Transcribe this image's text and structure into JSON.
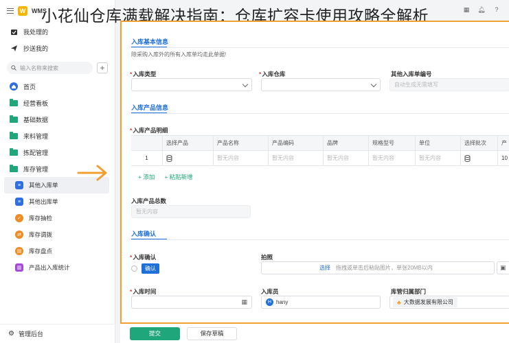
{
  "overlay_title": "小花仙仓库满载解决指南：仓库扩容卡使用攻略全解析",
  "app": {
    "name": "WMS",
    "logo_letter": "W"
  },
  "sidebar": {
    "top_items": [
      {
        "label": "我处理的",
        "icon": "inbox-check-icon"
      },
      {
        "label": "抄送我的",
        "icon": "send-icon"
      }
    ],
    "search_placeholder": "输入名称来搜索",
    "groups": [
      {
        "label": "首页",
        "icon": "home-icon"
      },
      {
        "label": "经营看板",
        "icon": "folder-icon"
      },
      {
        "label": "基础数据",
        "icon": "folder-icon"
      },
      {
        "label": "来料管理",
        "icon": "folder-icon"
      },
      {
        "label": "拣配管理",
        "icon": "folder-icon"
      },
      {
        "label": "库存管理",
        "icon": "folder-open-icon"
      }
    ],
    "sub_items": [
      {
        "label": "其他入库单",
        "icon": "document-icon",
        "color": "#2f6fe0"
      },
      {
        "label": "其他出库单",
        "icon": "document-icon",
        "color": "#2f6fe0"
      },
      {
        "label": "库存抽检",
        "icon": "shield-icon",
        "color": "#f08a24"
      },
      {
        "label": "库存调拨",
        "icon": "transfer-icon",
        "color": "#f08a24"
      },
      {
        "label": "库存盘点",
        "icon": "clipboard-icon",
        "color": "#f08a24"
      },
      {
        "label": "产品出入库统计",
        "icon": "chart-icon",
        "color": "#a64bd6"
      }
    ],
    "footer_label": "管理后台"
  },
  "form": {
    "section_basic": "入库基本信息",
    "basic_hint": "除采购入库外的所有入库单均走此单据!",
    "type_label": "入库类型",
    "warehouse_label": "入库仓库",
    "other_no_label": "其他入库单编号",
    "other_no_placeholder": "自动生成无需填写",
    "section_product": "入库产品信息",
    "detail_label": "入库产品明细",
    "table": {
      "headers": [
        "",
        "选择产品",
        "产品名称",
        "产品编码",
        "品牌",
        "规格型号",
        "单位",
        "选择批次",
        "产"
      ],
      "row": [
        "1",
        "",
        "暂无内容",
        "暂无内容",
        "暂无内容",
        "暂无内容",
        "暂无内容",
        "",
        "10"
      ]
    },
    "add_label": "添加",
    "paste_label": "粘贴新增",
    "total_label": "入库产品总数",
    "total_placeholder": "暂无内容",
    "section_confirm": "入库确认",
    "confirm_label": "入库确认",
    "confirm_tag": "确认",
    "photo_label": "拍照",
    "photo_select": "选择",
    "photo_hint": "拖拽或单击后粘贴图片，单张20MB以内",
    "time_label": "入库时间",
    "operator_label": "入库员",
    "operator_name": "hany",
    "operator_initial": "H",
    "dept_label": "库管归属部门",
    "dept_value": "大数据发展有限公司"
  },
  "footer": {
    "submit": "提交",
    "draft": "保存草稿"
  },
  "colors": {
    "accent": "#1e6fd9",
    "primary_button": "#1fa67a",
    "highlight_border": "#f0a030",
    "arrow": "#f0a030"
  }
}
